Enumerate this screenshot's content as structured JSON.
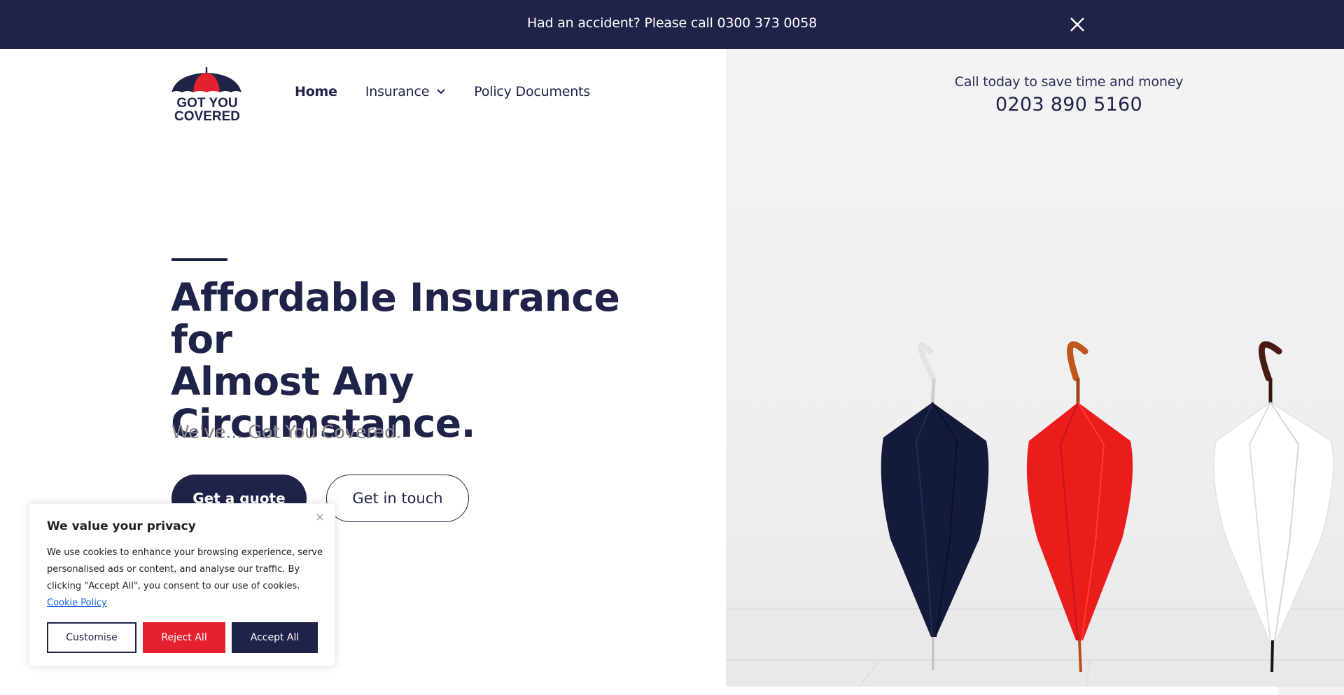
{
  "announcement": {
    "text": "Had an accident? Please call 0300 373 0058"
  },
  "logo": {
    "line1": "GOT YOU",
    "line2": "COVERED",
    "colors": {
      "navy": "#1f2349",
      "red": "#e5212f"
    }
  },
  "nav": {
    "items": [
      {
        "label": "Home",
        "active": true
      },
      {
        "label": "Insurance",
        "has_dropdown": true
      },
      {
        "label": "Policy Documents"
      }
    ]
  },
  "call": {
    "label": "Call today to save time and money",
    "number": "0203 890 5160"
  },
  "hero": {
    "title_lines": [
      "Affordable Insurance for",
      "Almost Any",
      "Circumstance."
    ],
    "subtitle": "We've... Got You Covered.",
    "primary_button": "Get a quote",
    "secondary_button": "Get in touch"
  },
  "cookie": {
    "title": "We value your privacy",
    "body": "We use cookies to enhance your browsing experience, serve personalised ads or content, and analyse our traffic. By clicking \"Accept All\", you consent to our use of cookies.",
    "link": "Cookie Policy",
    "buttons": {
      "customise": "Customise",
      "reject": "Reject All",
      "accept": "Accept All"
    }
  },
  "colors": {
    "brand_navy": "#1f2349",
    "brand_red": "#e5212f",
    "link_blue": "#1863dc",
    "subtitle_gray": "#8a8a8e"
  }
}
